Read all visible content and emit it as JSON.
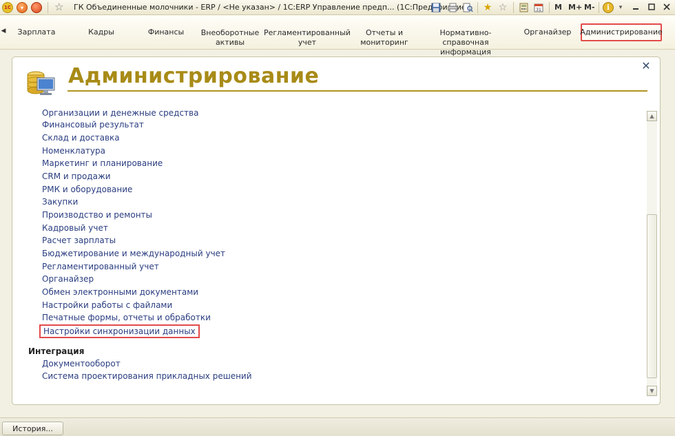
{
  "window": {
    "title": "ГК Объединенные молочники - ERP / <Не указан> / 1С:ERP Управление предп... (1С:Предприятие)",
    "logo_text": "1C",
    "m_buttons": [
      "M",
      "M+",
      "M-"
    ],
    "info_glyph": "i"
  },
  "sections": [
    {
      "label": "Зарплата"
    },
    {
      "label": "Кадры"
    },
    {
      "label": "Финансы"
    },
    {
      "label": "Внеоборотные активы"
    },
    {
      "label": "Регламентированный учет"
    },
    {
      "label": "Отчеты и мониторинг"
    },
    {
      "label": "Нормативно-справочная информация"
    },
    {
      "label": "Органайзер"
    },
    {
      "label": "Администрирование",
      "active": true
    }
  ],
  "page": {
    "title": "Администрирование",
    "close_glyph": "✕"
  },
  "links": [
    {
      "label": "Организации и денежные средства"
    },
    {
      "label": "Финансовый результат"
    },
    {
      "label": "Склад и доставка"
    },
    {
      "label": "Номенклатура"
    },
    {
      "label": "Маркетинг и планирование"
    },
    {
      "label": "CRM и продажи"
    },
    {
      "label": "РМК и оборудование"
    },
    {
      "label": "Закупки"
    },
    {
      "label": "Производство и ремонты"
    },
    {
      "label": "Кадровый учет"
    },
    {
      "label": "Расчет зарплаты"
    },
    {
      "label": "Бюджетирование и международный учет"
    },
    {
      "label": "Регламентированный учет"
    },
    {
      "label": "Органайзер"
    },
    {
      "label": "Обмен электронными документами"
    },
    {
      "label": "Настройки работы с файлами"
    },
    {
      "label": "Печатные формы, отчеты и обработки"
    },
    {
      "label": "Настройки синхронизации данных",
      "highlighted": true
    }
  ],
  "integration": {
    "title": "Интеграция",
    "links": [
      {
        "label": "Документооборот"
      },
      {
        "label": "Система проектирования прикладных решений"
      }
    ]
  },
  "bottom": {
    "history_label": "История..."
  },
  "colors": {
    "title": "#a88b17",
    "link": "#2a3d80",
    "highlight": "#e34a4a"
  },
  "icons": {
    "app": "1c-logo-icon",
    "menu": "main-menu-icon",
    "stop": "stop-icon",
    "favorite": "star-icon",
    "admin": "database-computer-icon",
    "close": "close-icon"
  }
}
